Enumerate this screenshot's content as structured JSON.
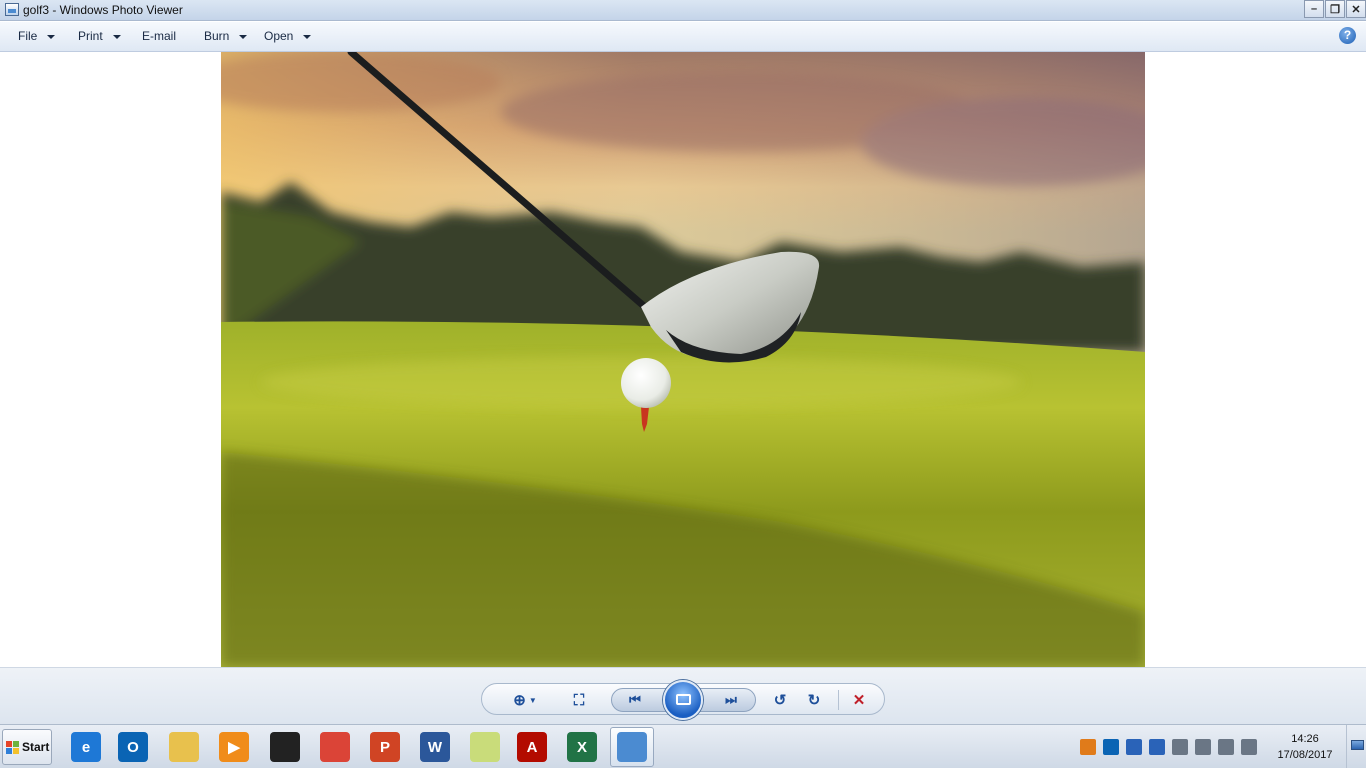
{
  "window": {
    "title": "golf3 - Windows Photo Viewer",
    "minimize_glyph": "–",
    "maximize_glyph": "❐",
    "close_glyph": "✕"
  },
  "menu": {
    "items": [
      {
        "label": "File",
        "has_dropdown": true
      },
      {
        "label": "Print",
        "has_dropdown": true
      },
      {
        "label": "E-mail",
        "has_dropdown": false
      },
      {
        "label": "Burn",
        "has_dropdown": true
      },
      {
        "label": "Open",
        "has_dropdown": true
      }
    ],
    "help_glyph": "?"
  },
  "photo": {
    "subject": "golf-driver-and-ball-on-tee"
  },
  "controls": {
    "zoom_glyph": "⊕",
    "fit_glyph": "⛶",
    "previous_glyph": "⏮",
    "next_glyph": "⏭",
    "rotate_ccw_glyph": "↺",
    "rotate_cw_glyph": "↻",
    "delete_glyph": "✕",
    "delete_color": "#c0202a"
  },
  "taskbar": {
    "start_label": "Start",
    "apps": [
      {
        "name": "internet-explorer",
        "letter": "e",
        "color": "#1e78d6"
      },
      {
        "name": "outlook",
        "letter": "O",
        "color": "#0a64b4"
      },
      {
        "name": "windows-explorer",
        "letter": "",
        "color": "#e8c14d"
      },
      {
        "name": "media-player",
        "letter": "▶",
        "color": "#f08c1a"
      },
      {
        "name": "photo-gallery",
        "letter": "",
        "color": "#222222"
      },
      {
        "name": "chrome",
        "letter": "",
        "color": "#db4437"
      },
      {
        "name": "powerpoint",
        "letter": "P",
        "color": "#d04424"
      },
      {
        "name": "word",
        "letter": "W",
        "color": "#2b579a"
      },
      {
        "name": "sticky-notes",
        "letter": "",
        "color": "#c9dc7a"
      },
      {
        "name": "acrobat",
        "letter": "A",
        "color": "#b30b00"
      },
      {
        "name": "excel",
        "letter": "X",
        "color": "#217346"
      },
      {
        "name": "photo-viewer",
        "letter": "",
        "color": "#4b8bd1"
      }
    ],
    "tray_icons": [
      {
        "name": "java-icon",
        "color": "#e07b1a"
      },
      {
        "name": "outlook-tray-icon",
        "color": "#0a64b4"
      },
      {
        "name": "bluetooth-icon",
        "color": "#2a63b8"
      },
      {
        "name": "security-shield-icon",
        "color": "#2a63b8"
      },
      {
        "name": "action-center-flag-icon",
        "color": "#6a7685"
      },
      {
        "name": "power-icon",
        "color": "#6a7685"
      },
      {
        "name": "network-signal-icon",
        "color": "#6a7685"
      },
      {
        "name": "volume-icon",
        "color": "#6a7685"
      }
    ],
    "clock": {
      "time": "14:26",
      "date": "17/08/2017"
    }
  }
}
